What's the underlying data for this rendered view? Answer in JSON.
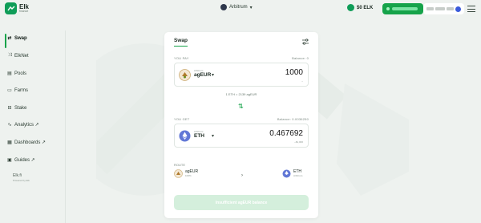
{
  "header": {
    "logo_name": "Elk",
    "logo_sub": "finance",
    "network": "Arbitrum",
    "network_chevron": "▾",
    "elk_price": "$0 ELK"
  },
  "sidebar": {
    "items": [
      {
        "label": "Swap",
        "icon": "swap-icon",
        "glyph": "⇄"
      },
      {
        "label": "ElkNet",
        "icon": "elknet-icon",
        "glyph": "⤨"
      },
      {
        "label": "Pools",
        "icon": "pools-icon",
        "glyph": "▤"
      },
      {
        "label": "Farms",
        "icon": "farms-icon",
        "glyph": "▭"
      },
      {
        "label": "Stake",
        "icon": "stake-icon",
        "glyph": "⊟"
      },
      {
        "label": "Analytics ↗",
        "icon": "analytics-icon",
        "glyph": "∿"
      },
      {
        "label": "Dashboards ↗",
        "icon": "dashboards-icon",
        "glyph": "▦"
      },
      {
        "label": "Guides ↗",
        "icon": "guides-icon",
        "glyph": "▣"
      }
    ],
    "footer_name": "Elk.fi",
    "footer_sub": "Powered by Elk"
  },
  "swap": {
    "title": "Swap",
    "you_pay_label": "YOU PAY",
    "pay_balance": "Balance: 0",
    "pay_chain": "Arbitrum",
    "pay_symbol": "agEUR",
    "pay_amount": "1000",
    "pay_amount_sub": "~",
    "rate": "1 ETH = 2139 agEUR",
    "flip_glyph": "⇅",
    "you_get_label": "YOU GET",
    "get_balance": "Balance: 0.0036250",
    "get_chain": "Arbitrum",
    "get_symbol": "ETH",
    "get_amount": "0.467692",
    "get_amount_sub": "~$1,000",
    "route_label": "ROUTE",
    "route_from": "agEUR",
    "route_from_sub": "100%",
    "route_to": "ETH",
    "route_to_sub": "Arbitrum",
    "route_arrow": "›",
    "cta_label": "Insufficient agEUR balance"
  },
  "colors": {
    "accent": "#16a34a",
    "cta_disabled": "#d4efdc",
    "background": "#eef2ef"
  }
}
